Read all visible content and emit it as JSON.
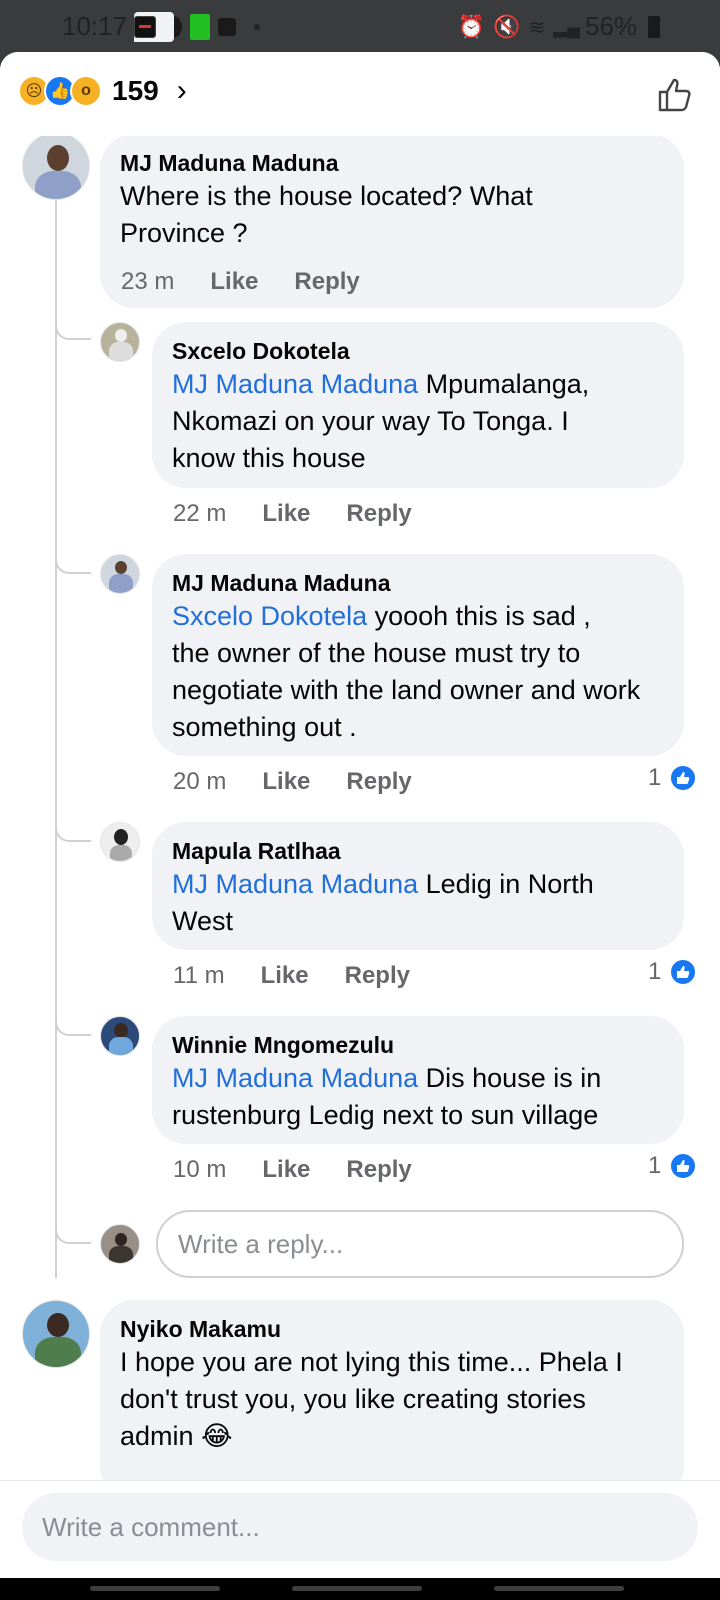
{
  "status_bar": {
    "time": "10:17",
    "battery": "56%"
  },
  "header": {
    "reaction_count": "159",
    "reactions": [
      "sad",
      "like",
      "wow"
    ]
  },
  "comments": [
    {
      "name": "MJ Maduna Maduna",
      "text": "Where is the house located? What Province ?",
      "time": "23 m",
      "like": "Like",
      "reply": "Reply"
    },
    {
      "name": "Sxcelo Dokotela",
      "mention": "MJ Maduna Maduna",
      "text_line1_rest": " Mpumalanga,",
      "text_rest": "Nkomazi on your way To Tonga. I know this house",
      "time": "22 m",
      "like": "Like",
      "reply": "Reply"
    },
    {
      "name": "MJ Maduna Maduna",
      "mention": "Sxcelo Dokotela",
      "text_line1_rest": " yoooh this is sad ,",
      "text_rest": "the owner of the house must try to negotiate with the land owner and work something out .",
      "time": "20 m",
      "like": "Like",
      "reply": "Reply",
      "likes": "1"
    },
    {
      "name": "Mapula Ratlhaa",
      "mention": "MJ Maduna Maduna",
      "text_line1_rest": " Ledig in North",
      "text_rest": "West",
      "time": "11 m",
      "like": "Like",
      "reply": "Reply",
      "likes": "1"
    },
    {
      "name": "Winnie Mngomezulu",
      "mention": "MJ Maduna Maduna",
      "text_line1_rest": " Dis house is in",
      "text_rest": "rustenburg Ledig next to sun village",
      "time": "10 m",
      "like": "Like",
      "reply": "Reply",
      "likes": "1"
    },
    {
      "name": "Nyiko Makamu",
      "text": "I hope you are not lying this time... Phela I don't trust you, you like creating stories admin 😂"
    }
  ],
  "reply_placeholder": "Write a reply...",
  "comment_placeholder": "Write a comment...",
  "colors": {
    "link": "#216fdb",
    "bubble": "#f0f2f5",
    "like_blue": "#1877f2"
  }
}
